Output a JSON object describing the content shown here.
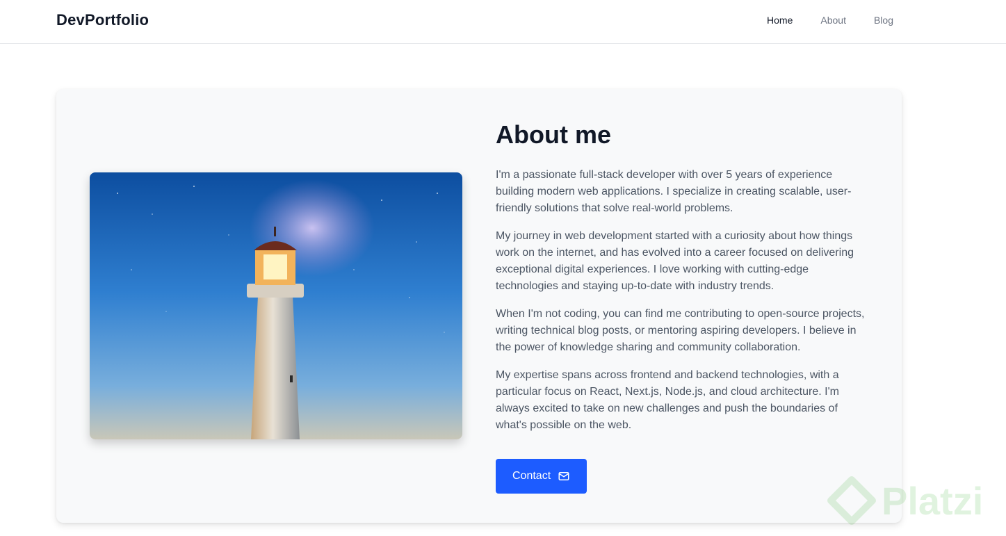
{
  "navbar": {
    "brand": "DevPortfolio",
    "links": [
      {
        "label": "Home",
        "active": true
      },
      {
        "label": "About",
        "active": false
      },
      {
        "label": "Blog",
        "active": false
      }
    ]
  },
  "about": {
    "heading": "About me",
    "image_icon": "lighthouse-photo",
    "paragraphs": [
      "I'm a passionate full-stack developer with over 5 years of experience building modern web applications. I specialize in creating scalable, user-friendly solutions that solve real-world problems.",
      "My journey in web development started with a curiosity about how things work on the internet, and has evolved into a career focused on delivering exceptional digital experiences. I love working with cutting-edge technologies and staying up-to-date with industry trends.",
      "When I'm not coding, you can find me contributing to open-source projects, writing technical blog posts, or mentoring aspiring developers. I believe in the power of knowledge sharing and community collaboration.",
      "My expertise spans across frontend and backend technologies, with a particular focus on React, Next.js, Node.js, and cloud architecture. I'm always excited to take on new challenges and push the boundaries of what's possible on the web."
    ],
    "contact_label": "Contact",
    "contact_icon": "mail-icon"
  },
  "watermark": {
    "text": "Platzi"
  },
  "colors": {
    "accent": "#1d5cff",
    "card_bg": "#f8f9fa",
    "text_muted": "#4b5563"
  }
}
